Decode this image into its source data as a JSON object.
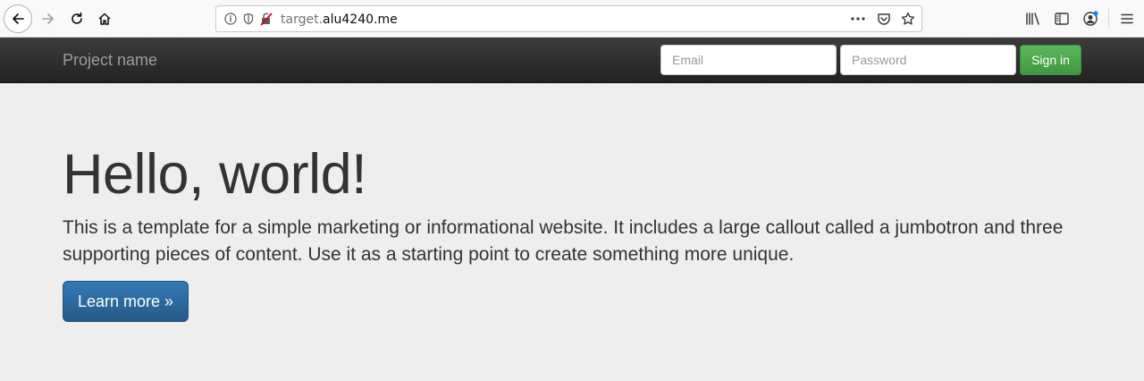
{
  "browser": {
    "url_prefix": "target.",
    "url_domain": "alu4240.me"
  },
  "navbar": {
    "brand": "Project name",
    "email_placeholder": "Email",
    "password_placeholder": "Password",
    "signin_label": "Sign in"
  },
  "jumbotron": {
    "title": "Hello, world!",
    "text": "This is a template for a simple marketing or informational website. It includes a large callout called a jumbotron and three supporting pieces of content. Use it as a starting point to create something more unique.",
    "button_label": "Learn more »"
  },
  "colors": {
    "navbar_bg": "#222222",
    "brand": "#9d9d9d",
    "signin_green": "#5cb85c",
    "primary_blue": "#337ab7",
    "jumbotron_bg": "#eeeeee"
  }
}
